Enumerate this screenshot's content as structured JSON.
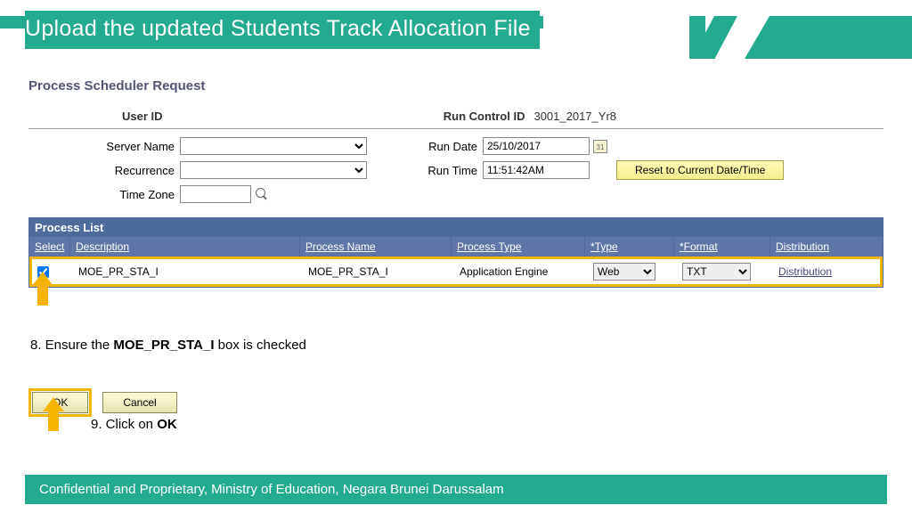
{
  "banner": {
    "title": "Upload the updated Students Track Allocation File"
  },
  "section_title": "Process Scheduler Request",
  "ids": {
    "user_label": "User ID",
    "run_control_label": "Run Control ID",
    "run_control_value": "3001_2017_Yr8"
  },
  "labels": {
    "server": "Server Name",
    "recurrence": "Recurrence",
    "timezone": "Time Zone",
    "run_date": "Run Date",
    "run_time": "Run Time"
  },
  "values": {
    "run_date": "25/10/2017",
    "run_time": "11:51:42AM",
    "timezone": ""
  },
  "reset_btn": "Reset to Current Date/Time",
  "process_list": {
    "title": "Process List",
    "headers": {
      "select": "Select",
      "description": "Description",
      "process_name": "Process Name",
      "process_type": "Process Type",
      "type": "*Type",
      "format": "*Format",
      "distribution": "Distribution"
    },
    "row": {
      "checked": true,
      "description": "MOE_PR_STA_I",
      "process_name": "MOE_PR_STA_I",
      "process_type": "Application Engine",
      "type": "Web",
      "format": "TXT",
      "distribution": "Distribution"
    }
  },
  "notes": {
    "step8a": "8. Ensure the ",
    "step8b": "MOE_PR_STA_I",
    "step8c": " box is checked",
    "step9a": "9. Click on ",
    "step9b": "OK"
  },
  "buttons": {
    "ok": "OK",
    "cancel": "Cancel"
  },
  "footer": "Confidential and Proprietary, Ministry of Education, Negara Brunei Darussalam"
}
